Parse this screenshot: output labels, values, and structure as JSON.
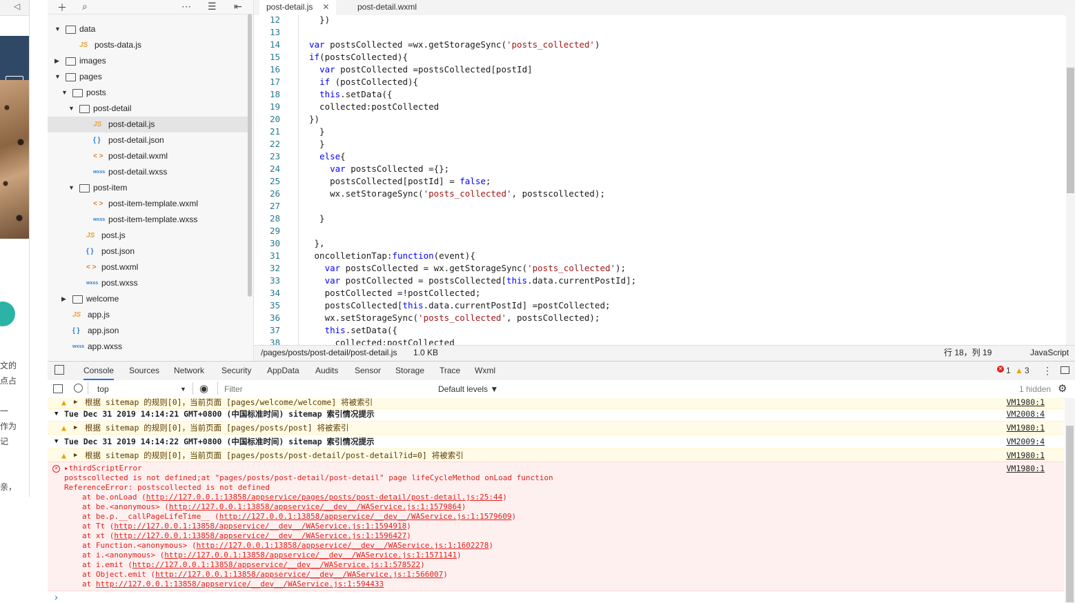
{
  "simulator": {
    "side_text": [
      "文的",
      "点占",
      "一",
      "作为",
      "记",
      "亲，"
    ]
  },
  "tree": {
    "items": [
      {
        "label": "data",
        "kind": "folder",
        "open": true,
        "depth": 0
      },
      {
        "label": "posts-data.js",
        "kind": "js",
        "depth": 1
      },
      {
        "label": "images",
        "kind": "folder",
        "open": false,
        "depth": 0
      },
      {
        "label": "pages",
        "kind": "folder",
        "open": true,
        "depth": 0
      },
      {
        "label": "posts",
        "kind": "folder",
        "open": true,
        "depth": 1
      },
      {
        "label": "post-detail",
        "kind": "folder",
        "open": true,
        "depth": 2
      },
      {
        "label": "post-detail.js",
        "kind": "js",
        "depth": 3,
        "selected": true
      },
      {
        "label": "post-detail.json",
        "kind": "json",
        "depth": 3
      },
      {
        "label": "post-detail.wxml",
        "kind": "wxml",
        "depth": 3
      },
      {
        "label": "post-detail.wxss",
        "kind": "wxss",
        "depth": 3
      },
      {
        "label": "post-item",
        "kind": "folder",
        "open": true,
        "depth": 2
      },
      {
        "label": "post-item-template.wxml",
        "kind": "wxml",
        "depth": 3
      },
      {
        "label": "post-item-template.wxss",
        "kind": "wxss",
        "depth": 3
      },
      {
        "label": "post.js",
        "kind": "js",
        "depth": 2
      },
      {
        "label": "post.json",
        "kind": "json",
        "depth": 2
      },
      {
        "label": "post.wxml",
        "kind": "wxml",
        "depth": 2
      },
      {
        "label": "post.wxss",
        "kind": "wxss",
        "depth": 2
      },
      {
        "label": "welcome",
        "kind": "folder",
        "open": false,
        "depth": 1
      },
      {
        "label": "app.js",
        "kind": "js",
        "depth": 0
      },
      {
        "label": "app.json",
        "kind": "json",
        "depth": 0
      },
      {
        "label": "app.wxss",
        "kind": "wxss",
        "depth": 0
      }
    ],
    "icon_glyphs": {
      "js": "JS",
      "json": "{ }",
      "wxml": "< >",
      "wxss": "wxss"
    }
  },
  "editor": {
    "tabs": [
      {
        "label": "post-detail.js",
        "active": true
      },
      {
        "label": "post-detail.wxml",
        "active": false
      }
    ],
    "close_glyph": "✕",
    "lines": [
      {
        "n": "12",
        "text": "  })"
      },
      {
        "n": "13",
        "text": ""
      },
      {
        "n": "14",
        "text": "var postsCollected =wx.getStorageSync('posts_collected')"
      },
      {
        "n": "15",
        "text": "if(postsCollected){"
      },
      {
        "n": "16",
        "text": "  var postCollected =postsCollected[postId]"
      },
      {
        "n": "17",
        "text": "  if (postCollected){"
      },
      {
        "n": "18",
        "text": "  this.setData({"
      },
      {
        "n": "19",
        "text": "  collected:postCollected"
      },
      {
        "n": "20",
        "text": "})"
      },
      {
        "n": "21",
        "text": "  }"
      },
      {
        "n": "22",
        "text": "  }"
      },
      {
        "n": "23",
        "text": "  else{"
      },
      {
        "n": "24",
        "text": "    var postsCollected ={};"
      },
      {
        "n": "25",
        "text": "    postsCollected[postId] = false;"
      },
      {
        "n": "26",
        "text": "    wx.setStorageSync('posts_collected', postscollected);"
      },
      {
        "n": "27",
        "text": ""
      },
      {
        "n": "28",
        "text": "  }"
      },
      {
        "n": "29",
        "text": ""
      },
      {
        "n": "30",
        "text": " },"
      },
      {
        "n": "31",
        "text": " oncolletionTap:function(event){"
      },
      {
        "n": "32",
        "text": "   var postsCollected = wx.getStorageSync('posts_collected');"
      },
      {
        "n": "33",
        "text": "   var postCollected = postsCollected[this.data.currentPostId];"
      },
      {
        "n": "34",
        "text": "   postCollected =!postCollected;"
      },
      {
        "n": "35",
        "text": "   postsCollected[this.data.currentPostId] =postCollected;"
      },
      {
        "n": "36",
        "text": "   wx.setStorageSync('posts_collected', postsCollected);"
      },
      {
        "n": "37",
        "text": "   this.setData({"
      },
      {
        "n": "38",
        "text": "     collected:postCollected"
      }
    ]
  },
  "status_bar": {
    "path": "/pages/posts/post-detail/post-detail.js",
    "size": "1.0 KB",
    "cursor": "行 18，列 19",
    "language": "JavaScript"
  },
  "devtools": {
    "tabs": [
      "Console",
      "Sources",
      "Network",
      "Security",
      "AppData",
      "Audits",
      "Sensor",
      "Storage",
      "Trace",
      "Wxml"
    ],
    "active_tab": "Console",
    "error_count": "1",
    "warning_count": "3",
    "context": "top",
    "filter_placeholder": "Filter",
    "levels": "Default levels ▼",
    "hidden": "1 hidden"
  },
  "console": {
    "rows": [
      {
        "type": "warn",
        "text": "根据 sitemap 的规则[0]，当前页面 [pages/welcome/welcome] 将被索引",
        "src": "VM1980:1"
      },
      {
        "type": "group",
        "text": "Tue Dec 31 2019 14:14:21 GMT+0800 (中国标准时间) sitemap 索引情况提示",
        "src": "VM2008:4"
      },
      {
        "type": "warn",
        "text": "根据 sitemap 的规则[0]，当前页面 [pages/posts/post] 将被索引",
        "src": "VM1980:1"
      },
      {
        "type": "group",
        "text": "Tue Dec 31 2019 14:14:22 GMT+0800 (中国标准时间) sitemap 索引情况提示",
        "src": "VM2009:4"
      },
      {
        "type": "warn",
        "text": "根据 sitemap 的规则[0]，当前页面 [pages/posts/post-detail/post-detail?id=0] 将被索引",
        "src": "VM1980:1"
      }
    ],
    "error": {
      "title": "thirdScriptError",
      "src": "VM1980:1",
      "message": "postscollected is not defined;at \"pages/posts/post-detail/post-detail\" page lifeCycleMethod onLoad function",
      "ref": "ReferenceError: postscollected is not defined",
      "stack": [
        {
          "fn": "at be.onLoad (",
          "url": "http://127.0.0.1:13858/appservice/pages/posts/post-detail/post-detail.js:25:44",
          "end": ")"
        },
        {
          "fn": "at be.<anonymous> (",
          "url": "http://127.0.0.1:13858/appservice/__dev__/WAService.js:1:1579864",
          "end": ")"
        },
        {
          "fn": "at be.p.__callPageLifeTime__ (",
          "url": "http://127.0.0.1:13858/appservice/__dev__/WAService.js:1:1579609",
          "end": ")"
        },
        {
          "fn": "at Tt (",
          "url": "http://127.0.0.1:13858/appservice/__dev__/WAService.js:1:1594918",
          "end": ")"
        },
        {
          "fn": "at xt (",
          "url": "http://127.0.0.1:13858/appservice/__dev__/WAService.js:1:1596427",
          "end": ")"
        },
        {
          "fn": "at Function.<anonymous> (",
          "url": "http://127.0.0.1:13858/appservice/__dev__/WAService.js:1:1602278",
          "end": ")"
        },
        {
          "fn": "at i.<anonymous> (",
          "url": "http://127.0.0.1:13858/appservice/__dev__/WAService.js:1:1571141",
          "end": ")"
        },
        {
          "fn": "at i.emit (",
          "url": "http://127.0.0.1:13858/appservice/__dev__/WAService.js:1:578522",
          "end": ")"
        },
        {
          "fn": "at Object.emit (",
          "url": "http://127.0.0.1:13858/appservice/__dev__/WAService.js:1:566007",
          "end": ")"
        },
        {
          "fn": "at ",
          "url": "http://127.0.0.1:13858/appservice/__dev__/WAService.js:1:594433",
          "end": ""
        }
      ]
    },
    "prompt": "›"
  }
}
